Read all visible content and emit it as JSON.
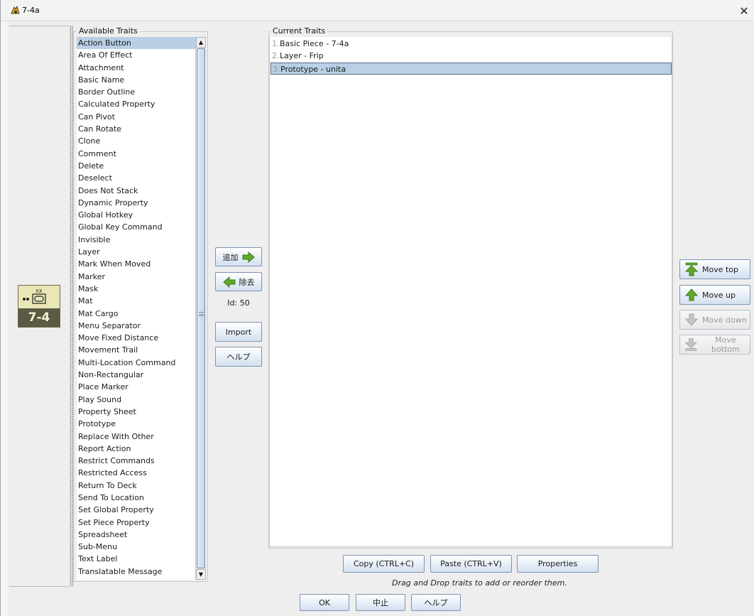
{
  "window": {
    "title": "7-4a",
    "close_glyph": "✕"
  },
  "piece": {
    "label": "7-4",
    "top_mark": "XX"
  },
  "available": {
    "title": "Available Traits",
    "items": [
      "Action Button",
      "Area Of Effect",
      "Attachment",
      "Basic Name",
      "Border Outline",
      "Calculated Property",
      "Can Pivot",
      "Can Rotate",
      "Clone",
      "Comment",
      "Delete",
      "Deselect",
      "Does Not Stack",
      "Dynamic Property",
      "Global Hotkey",
      "Global Key Command",
      "Invisible",
      "Layer",
      "Mark When Moved",
      "Marker",
      "Mask",
      "Mat",
      "Mat Cargo",
      "Menu Separator",
      "Move Fixed Distance",
      "Movement Trail",
      "Multi-Location Command",
      "Non-Rectangular",
      "Place Marker",
      "Play Sound",
      "Property Sheet",
      "Prototype",
      "Replace With Other",
      "Report Action",
      "Restrict Commands",
      "Restricted Access",
      "Return To Deck",
      "Send To Location",
      "Set Global Property",
      "Set Piece Property",
      "Spreadsheet",
      "Sub-Menu",
      "Text Label",
      "Translatable Message"
    ],
    "selected_index": 0
  },
  "middle": {
    "add_label": "追加",
    "remove_label": "除去",
    "id_label": "Id: 50",
    "import_label": "Import",
    "help_label": "ヘルプ"
  },
  "current": {
    "title": "Current Traits",
    "items": [
      {
        "num": "1.",
        "label": "Basic Piece - 7-4a"
      },
      {
        "num": "2.",
        "label": "Layer - Frip"
      },
      {
        "num": "3.",
        "label": "Prototype - unita"
      }
    ],
    "selected_index": 2
  },
  "move": {
    "top_label": "Move top",
    "up_label": "Move up",
    "down_label": "Move down",
    "bottom_label": "Move bottom"
  },
  "bottom": {
    "copy_label": "Copy (CTRL+C)",
    "paste_label": "Paste (CTRL+V)",
    "properties_label": "Properties",
    "hint": "Drag and Drop traits to add or reorder them.",
    "ok_label": "OK",
    "cancel_label": "中止",
    "help_label": "ヘルプ"
  },
  "colors": {
    "selection": "#b8cfe5",
    "arrow_green": "#5faa2a",
    "button_border": "#7c93b4"
  }
}
